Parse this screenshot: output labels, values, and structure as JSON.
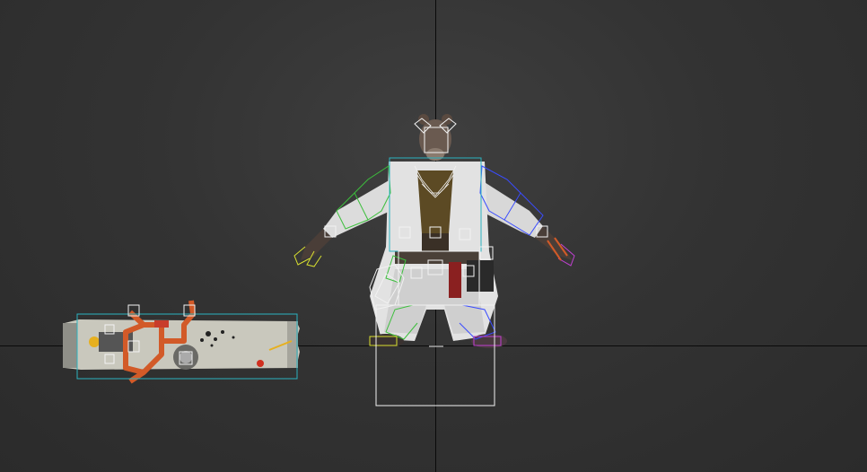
{
  "viewport": {
    "label": "",
    "colors": {
      "background": "#333333",
      "grid_axis": "#0a0a0a",
      "selection_cyan": "#2bb3c0",
      "bone_white": "#f2f2f2",
      "rig_left_green": "#3cbf3c",
      "rig_right_blue": "#3a4cff",
      "hand_yellow": "#d8e030",
      "hand_purple": "#c040d0",
      "weapon_orange": "#d25a28"
    }
  },
  "scene": {
    "objects": [
      {
        "name": "bear-character",
        "icon": "character-mesh"
      },
      {
        "name": "chainsaw-weapon",
        "icon": "weapon-mesh"
      }
    ]
  }
}
